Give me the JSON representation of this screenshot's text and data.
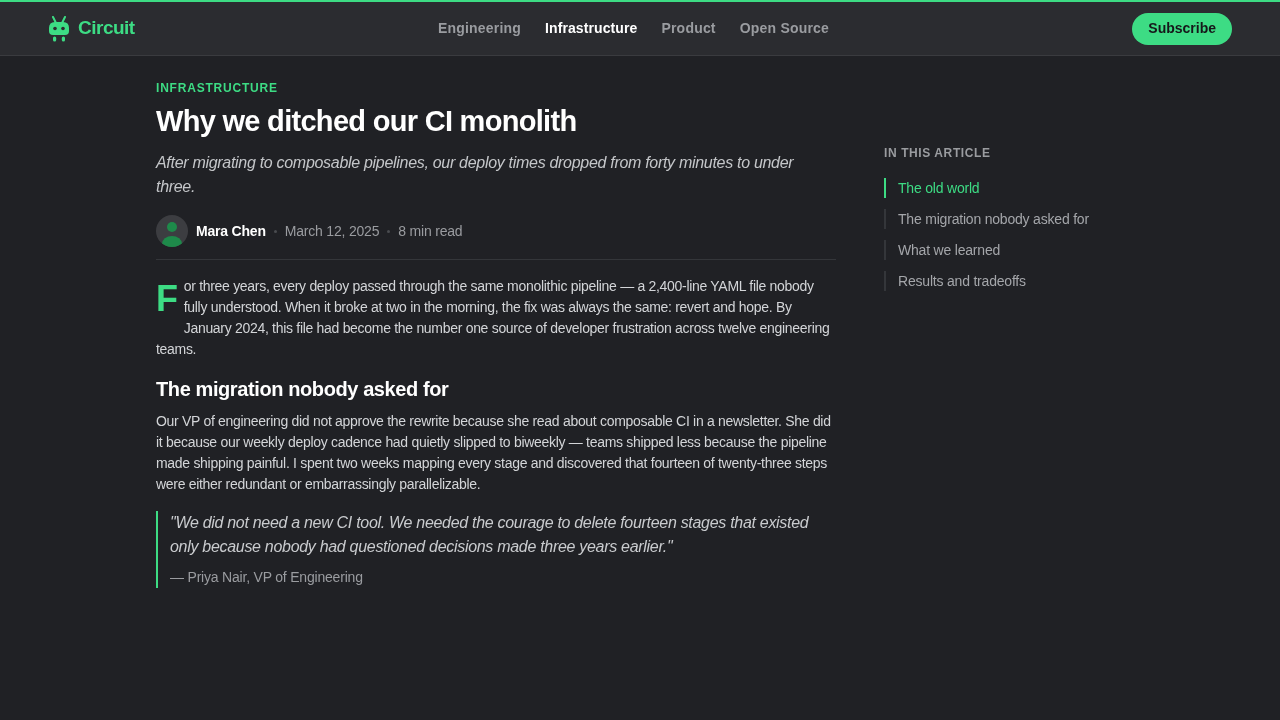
{
  "header": {
    "logo": "Circuit",
    "nav": [
      {
        "label": "Engineering",
        "selected": false
      },
      {
        "label": "Infrastructure",
        "selected": true
      },
      {
        "label": "Product",
        "selected": false
      },
      {
        "label": "Open Source",
        "selected": false
      }
    ],
    "subscribe": "Subscribe"
  },
  "article": {
    "category": "INFRASTRUCTURE",
    "title": "Why we ditched our CI monolith",
    "subtitle": "After migrating to composable pipelines, our deploy times dropped from forty minutes to under three.",
    "author": "Mara Chen",
    "date": "March 12, 2025",
    "read_time": "8 min read",
    "intro": {
      "drop_cap": "F",
      "text": "or three years, every deploy passed through the same monolithic pipeline — a 2,400-line YAML file nobody fully understood. When it broke at two in the morning, the fix was always the same: revert and hope. By January 2024, this file had become the number one source of developer frustration across twelve engineering teams."
    },
    "sections": [
      {
        "heading": "The migration nobody asked for",
        "paragraph": "Our VP of engineering did not approve the rewrite because she read about composable CI in a newsletter. She did it because our weekly deploy cadence had quietly slipped to biweekly — teams shipped less because the pipeline made shipping painful. I spent two weeks mapping every stage and discovered that fourteen of twenty-three steps were either redundant or embarrassingly parallelizable."
      }
    ],
    "quote": {
      "text": "\"We did not need a new CI tool. We needed the courage to delete fourteen stages that existed only because nobody had questioned decisions made three years earlier.\"",
      "attribution": "— Priya Nair, VP of Engineering"
    }
  },
  "toc": {
    "title": "IN THIS ARTICLE",
    "items": [
      {
        "label": "The old world",
        "selected": true
      },
      {
        "label": "The migration nobody asked for",
        "selected": false
      },
      {
        "label": "What we learned",
        "selected": false
      },
      {
        "label": "Results and tradeoffs",
        "selected": false
      }
    ]
  }
}
